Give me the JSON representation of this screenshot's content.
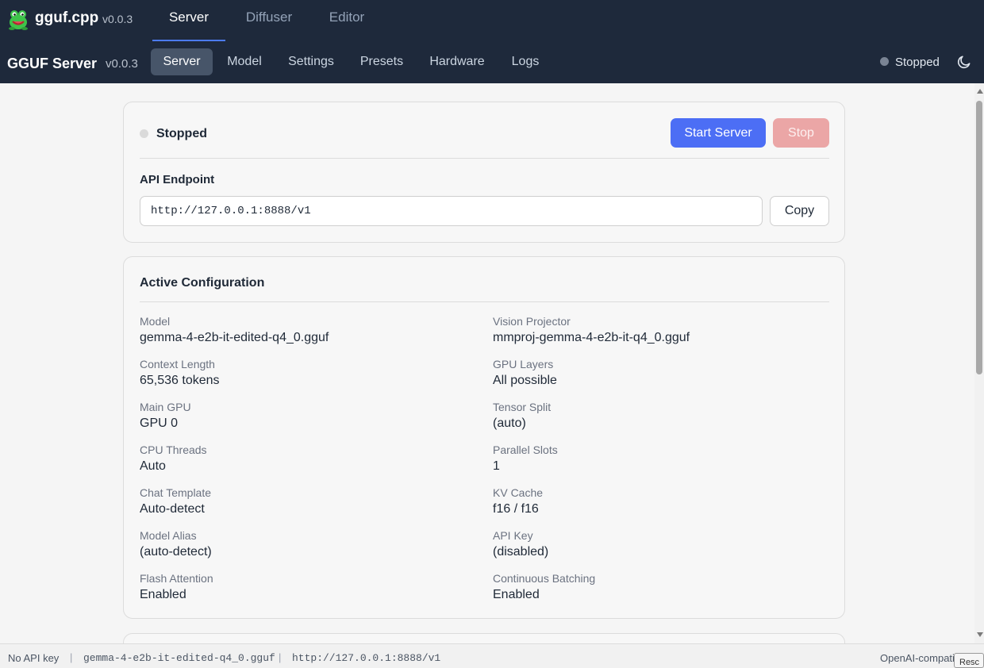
{
  "app": {
    "name": "gguf.cpp",
    "version": "v0.0.3"
  },
  "top_tabs": [
    {
      "label": "Server"
    },
    {
      "label": "Diffuser"
    },
    {
      "label": "Editor"
    }
  ],
  "nav": {
    "title": "GGUF Server",
    "version": "v0.0.3",
    "tabs": [
      {
        "label": "Server"
      },
      {
        "label": "Model"
      },
      {
        "label": "Settings"
      },
      {
        "label": "Presets"
      },
      {
        "label": "Hardware"
      },
      {
        "label": "Logs"
      }
    ],
    "status": "Stopped"
  },
  "server_card": {
    "status": "Stopped",
    "start_label": "Start Server",
    "stop_label": "Stop",
    "endpoint_label": "API Endpoint",
    "endpoint_value": "http://127.0.0.1:8888/v1",
    "copy_label": "Copy"
  },
  "config": {
    "title": "Active Configuration",
    "fields": [
      {
        "label": "Model",
        "value": "gemma-4-e2b-it-edited-q4_0.gguf"
      },
      {
        "label": "Vision Projector",
        "value": "mmproj-gemma-4-e2b-it-q4_0.gguf"
      },
      {
        "label": "Context Length",
        "value": "65,536 tokens"
      },
      {
        "label": "GPU Layers",
        "value": "All possible"
      },
      {
        "label": "Main GPU",
        "value": "GPU 0"
      },
      {
        "label": "Tensor Split",
        "value": "(auto)"
      },
      {
        "label": "CPU Threads",
        "value": "Auto"
      },
      {
        "label": "Parallel Slots",
        "value": "1"
      },
      {
        "label": "Chat Template",
        "value": "Auto-detect"
      },
      {
        "label": "KV Cache",
        "value": "f16 / f16"
      },
      {
        "label": "Model Alias",
        "value": "(auto-detect)"
      },
      {
        "label": "API Key",
        "value": "(disabled)"
      },
      {
        "label": "Flash Attention",
        "value": "Enabled"
      },
      {
        "label": "Continuous Batching",
        "value": "Enabled"
      }
    ]
  },
  "statusbar": {
    "api_key": "No API key",
    "model": "gemma-4-e2b-it-edited-q4_0.gguf",
    "url": "http://127.0.0.1:8888/v1",
    "right": "OpenAI-compatible",
    "separator": "|",
    "overlay": "Resc"
  },
  "colors": {
    "header_bg": "#1e293b",
    "accent": "#4c6ef5",
    "stop_button": "#eba6a6",
    "status_dot": "#7a8494"
  }
}
